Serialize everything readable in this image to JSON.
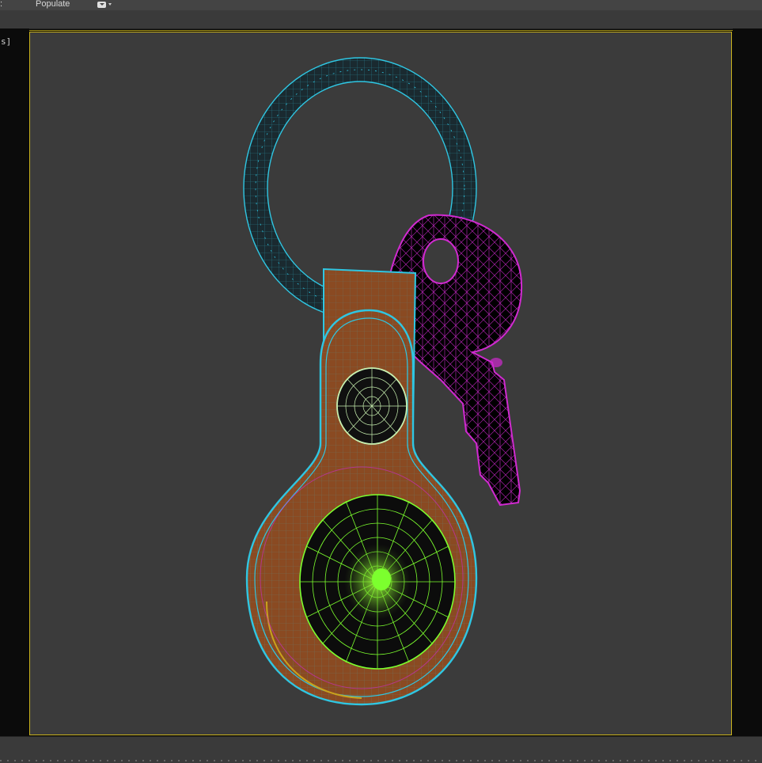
{
  "menu": {
    "items": [
      ":",
      "Populate"
    ],
    "dropdown_icon": "chevron-down-icon"
  },
  "viewport": {
    "label": "s]",
    "border_color": "#c9b21c",
    "background": "#3b3b3b",
    "objects": [
      {
        "name": "key-ring",
        "wire_color": "#2fc6e2"
      },
      {
        "name": "leather-strap",
        "wire_color": "#2fc6e2",
        "fill": "#8a4a22"
      },
      {
        "name": "key",
        "wire_color": "#d02ad0"
      },
      {
        "name": "airtag-disc",
        "wire_color": "#7cff2e"
      },
      {
        "name": "rivet",
        "wire_color": "#c8f0b0"
      }
    ]
  }
}
